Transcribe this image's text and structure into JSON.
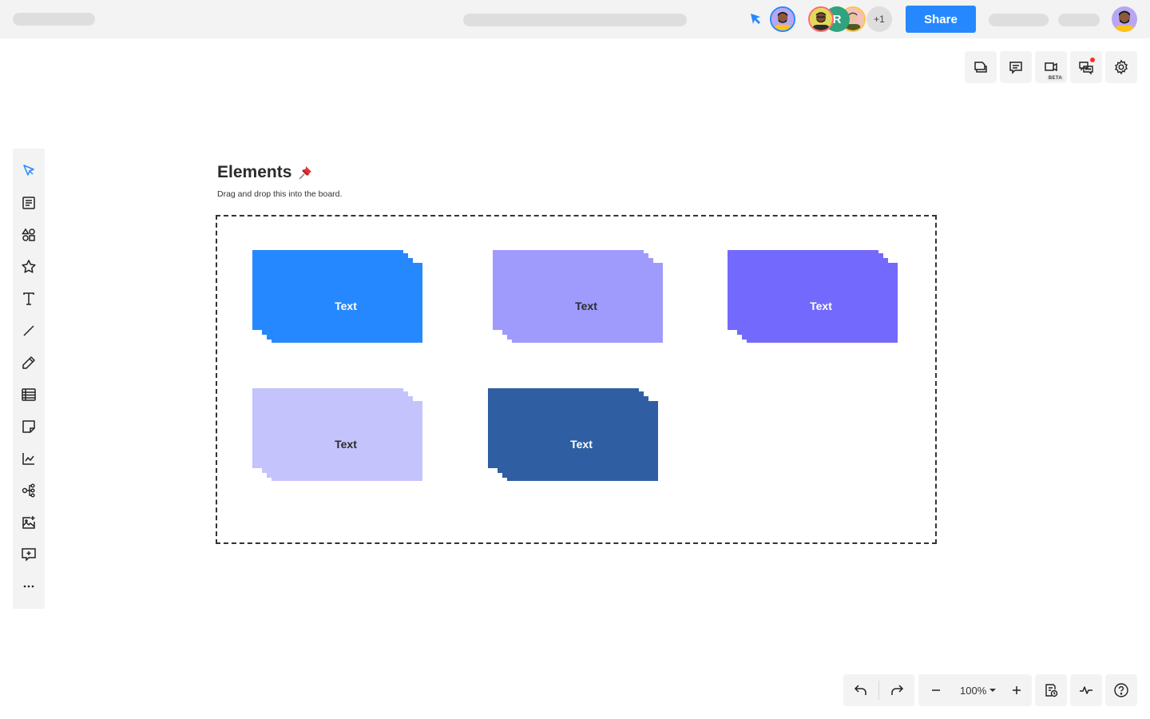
{
  "header": {
    "share_label": "Share",
    "collaborator_initial": "R",
    "more_collaborators": "+1",
    "colors": {
      "accent": "#2688ff"
    }
  },
  "top_tools": [
    {
      "name": "pages",
      "icon": "pages-icon"
    },
    {
      "name": "comments",
      "icon": "comment-icon"
    },
    {
      "name": "video",
      "icon": "video-icon",
      "badge": "BETA"
    },
    {
      "name": "chat",
      "icon": "chat-icon",
      "notification": true
    },
    {
      "name": "settings",
      "icon": "gear-icon"
    }
  ],
  "left_toolbar": [
    {
      "name": "select",
      "icon": "pointer-icon",
      "active": true
    },
    {
      "name": "templates",
      "icon": "template-icon"
    },
    {
      "name": "shapes",
      "icon": "shapes-icon"
    },
    {
      "name": "stickers",
      "icon": "star-icon"
    },
    {
      "name": "text",
      "icon": "text-icon"
    },
    {
      "name": "line",
      "icon": "line-icon"
    },
    {
      "name": "pen",
      "icon": "pencil-icon"
    },
    {
      "name": "table",
      "icon": "table-icon"
    },
    {
      "name": "sticky-note",
      "icon": "sticky-note-icon"
    },
    {
      "name": "chart",
      "icon": "chart-icon"
    },
    {
      "name": "mind-map",
      "icon": "mindmap-icon"
    },
    {
      "name": "image",
      "icon": "image-add-icon"
    },
    {
      "name": "comment",
      "icon": "comment-add-icon"
    },
    {
      "name": "more",
      "icon": "more-icon"
    }
  ],
  "board": {
    "title": "Elements",
    "title_emoji": "pushpin-icon",
    "subtitle": "Drag and drop this into the board.",
    "cards": [
      {
        "label": "Text",
        "color": "#2688ff",
        "text_color": "#ffffff"
      },
      {
        "label": "Text",
        "color": "#9f9bfd",
        "text_color": "#2b2b2b"
      },
      {
        "label": "Text",
        "color": "#7369fd",
        "text_color": "#ffffff"
      },
      {
        "label": "Text",
        "color": "#c5c3fb",
        "text_color": "#2b2b2b"
      },
      {
        "label": "Text",
        "color": "#2f5fa2",
        "text_color": "#ffffff"
      }
    ]
  },
  "bottom_bar": {
    "zoom_level": "100%",
    "undo": "undo-icon",
    "redo": "redo-icon",
    "zoom_out": "minus-icon",
    "zoom_in": "plus-icon",
    "history": "history-icon",
    "activity": "activity-icon",
    "help": "help-icon"
  }
}
